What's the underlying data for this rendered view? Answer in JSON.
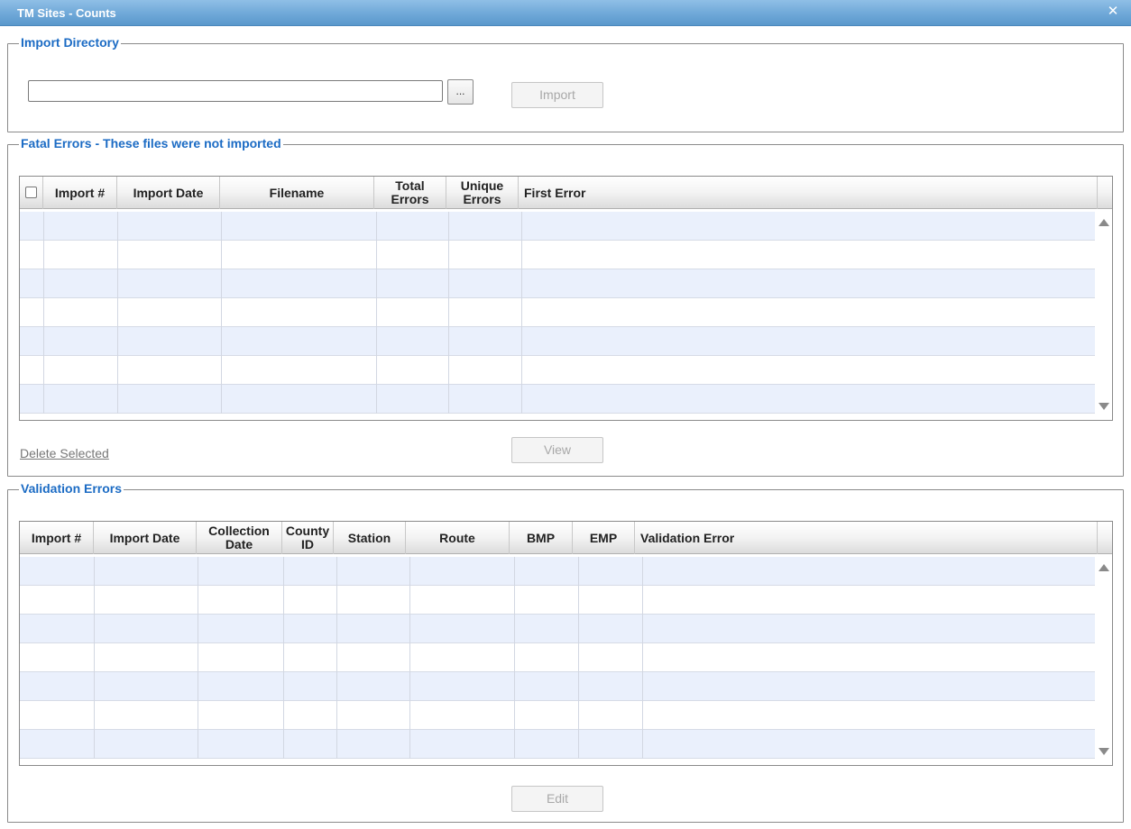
{
  "window": {
    "title": "TM Sites - Counts",
    "close_icon": "close-icon"
  },
  "import_directory": {
    "legend": "Import Directory",
    "path_value": "",
    "browse_label": "...",
    "import_label": "Import"
  },
  "fatal_errors": {
    "legend": "Fatal Errors - These files were not imported",
    "columns": [
      "Import #",
      "Import Date",
      "Filename",
      "Total\nErrors",
      "Unique\nErrors",
      "First Error"
    ],
    "rows": [],
    "delete_label": "Delete Selected",
    "view_label": "View"
  },
  "validation_errors": {
    "legend": "Validation Errors",
    "columns": [
      "Import #",
      "Import Date",
      "Collection\nDate",
      "County\nID",
      "Station",
      "Route",
      "BMP",
      "EMP",
      "Validation Error"
    ],
    "rows": [],
    "edit_label": "Edit"
  },
  "colors": {
    "legend": "#1b6bc4",
    "row_alt": "#eaf0fc",
    "titlebar": "#6fa8d8"
  }
}
